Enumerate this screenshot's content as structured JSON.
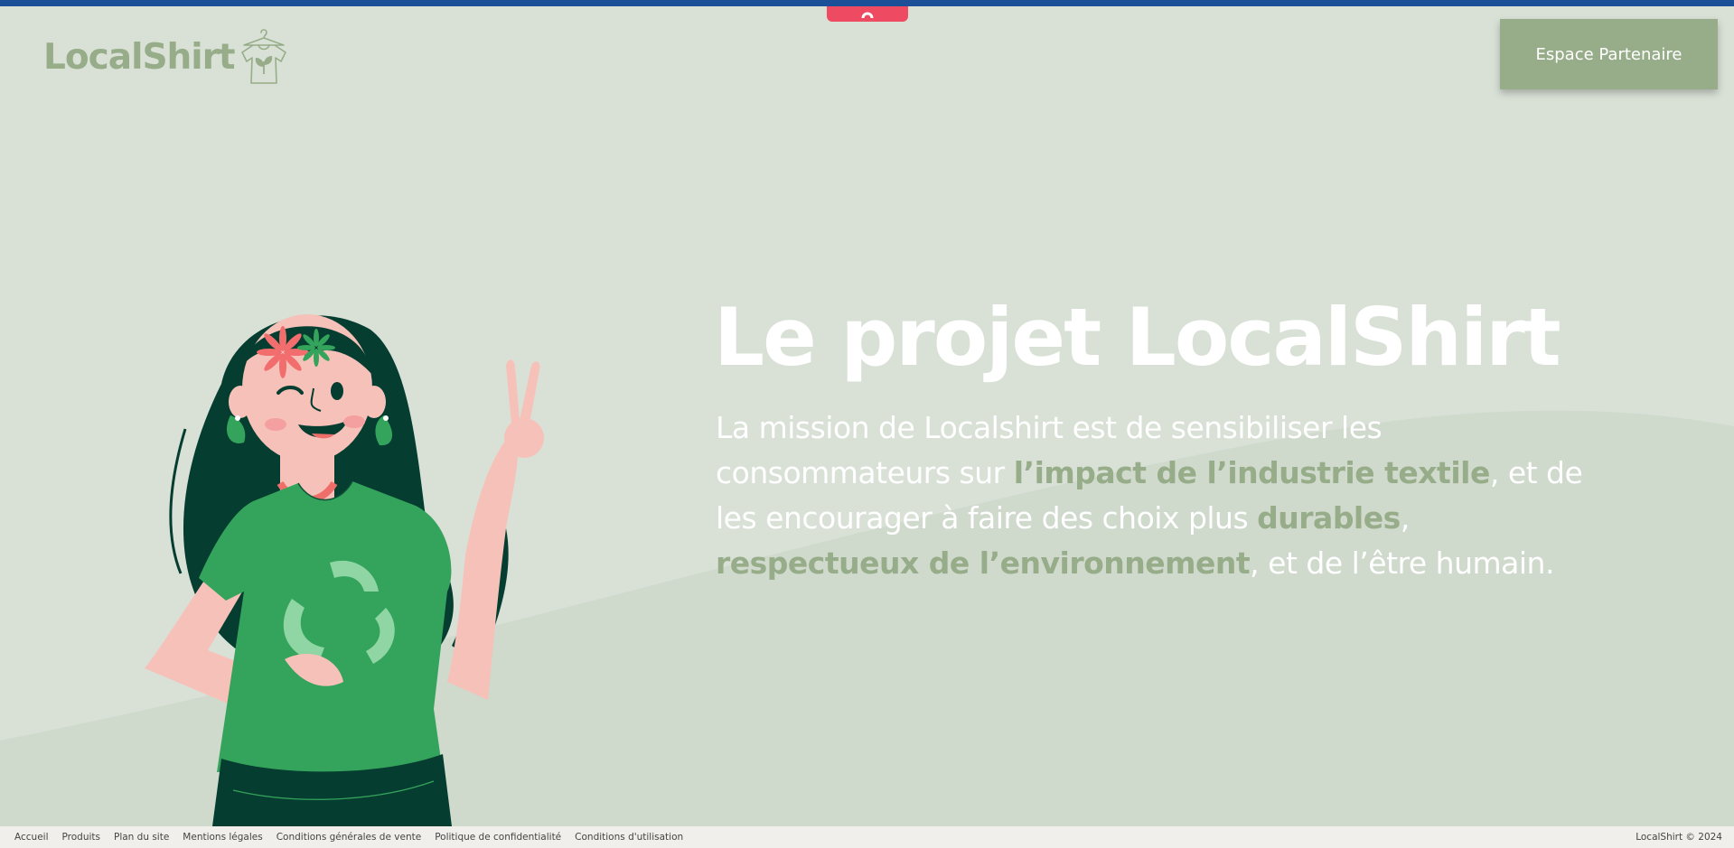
{
  "brand": {
    "name": "LocalShirt"
  },
  "header": {
    "partner_button": "Espace Partenaire"
  },
  "hero": {
    "title": "Le projet LocalShirt",
    "mission": [
      {
        "text": "La mission de Localshirt est de sensibiliser les consommateurs sur ",
        "em": false
      },
      {
        "text": "l’impact de l’industrie textile",
        "em": true
      },
      {
        "text": ", et de les encourager à faire des choix plus ",
        "em": false
      },
      {
        "text": "durables",
        "em": true
      },
      {
        "text": ", ",
        "em": false
      },
      {
        "text": "respectueux de l’environnement",
        "em": true
      },
      {
        "text": ", et de l’être humain.",
        "em": false
      }
    ]
  },
  "footer": {
    "links": [
      "Accueil",
      "Produits",
      "Plan du site",
      "Mentions légales",
      "Conditions générales de vente",
      "Politique de confidentialité",
      "Conditions d'utilisation"
    ],
    "copyright": "LocalShirt © 2024"
  },
  "icons": {
    "logo": "hanger-tshirt-leaf-icon",
    "top_tab": "chevron-up-icon",
    "illustration": "woman-recycle-tshirt-illustration"
  },
  "colors": {
    "accent": "#97ad89",
    "background": "#d9e1d7",
    "top_bar": "#1b4f97",
    "tab": "#ee4a62",
    "footer": "#f1efeb"
  }
}
